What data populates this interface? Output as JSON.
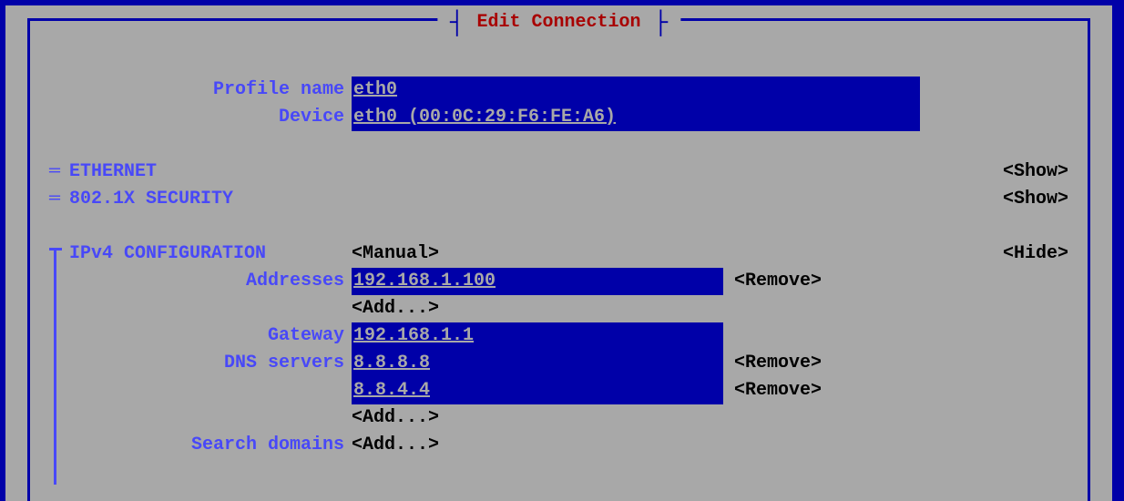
{
  "title": "Edit Connection",
  "profile": {
    "name_label": "Profile name",
    "name_value": "eth0",
    "device_label": "Device",
    "device_value": "eth0 (00:0C:29:F6:FE:A6)"
  },
  "sections": {
    "ethernet": {
      "prefix": "═",
      "label": "ETHERNET",
      "toggle": "<Show>"
    },
    "security": {
      "prefix": "═",
      "label": "802.1X SECURITY",
      "toggle": "<Show>"
    }
  },
  "ipv4": {
    "label": "IPv4 CONFIGURATION",
    "mode": "<Manual>",
    "toggle": "<Hide>",
    "addresses_label": "Addresses",
    "addresses": [
      "192.168.1.100"
    ],
    "gateway_label": "Gateway",
    "gateway": "192.168.1.1",
    "dns_label": "DNS servers",
    "dns": [
      "8.8.8.8",
      "8.8.4.4"
    ],
    "search_label": "Search domains"
  },
  "actions": {
    "remove": "<Remove>",
    "add": "<Add...>"
  }
}
